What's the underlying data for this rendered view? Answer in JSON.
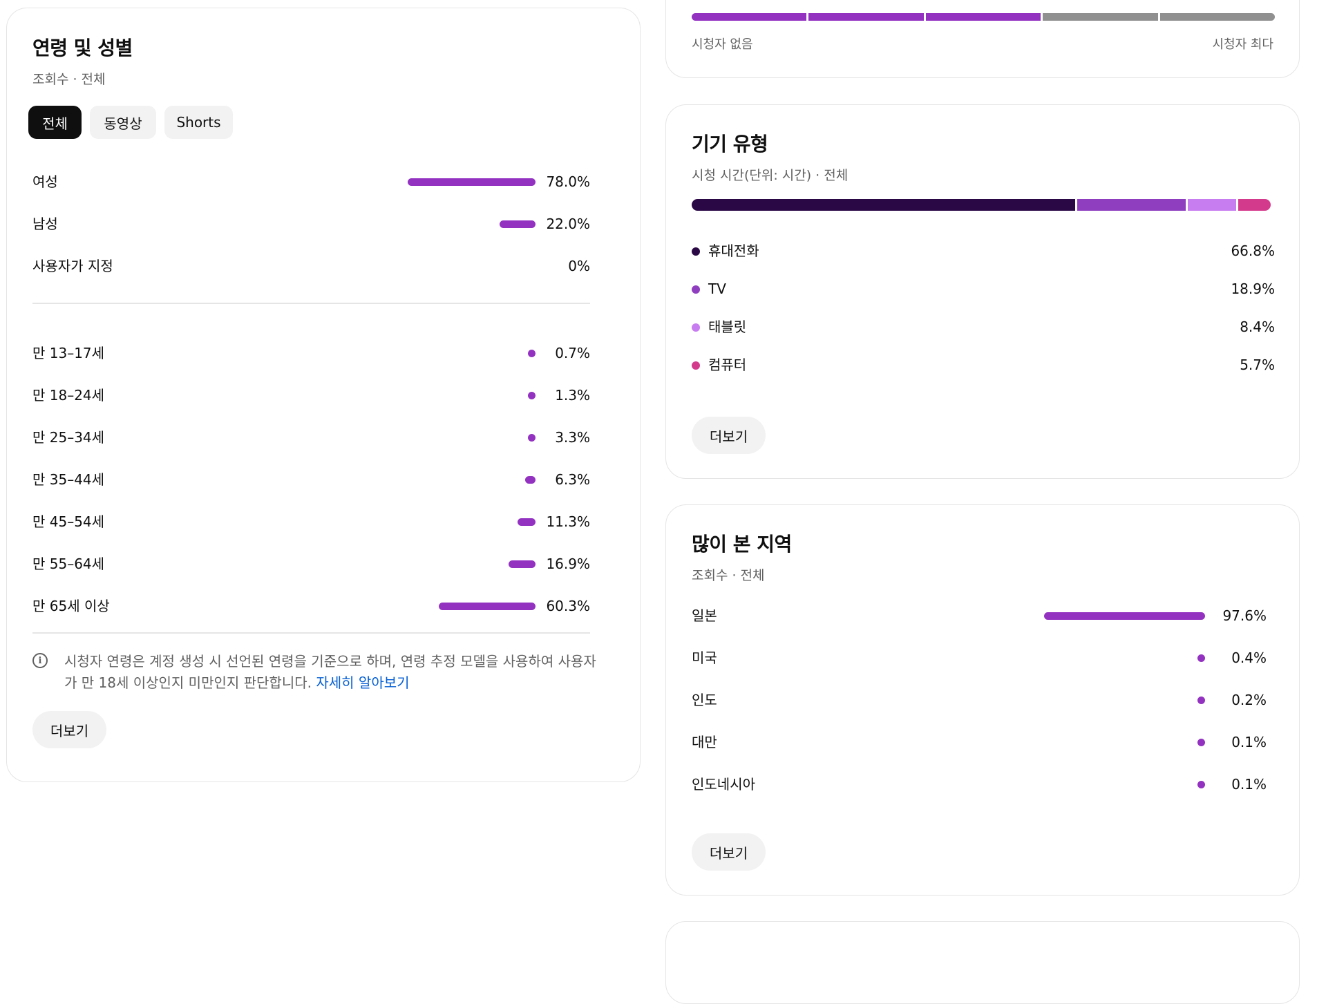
{
  "age_gender": {
    "title": "연령 및 성별",
    "subtitle": "조회수 · 전체",
    "chips": [
      {
        "label": "전체",
        "active": true
      },
      {
        "label": "동영상",
        "active": false
      },
      {
        "label": "Shorts",
        "active": false
      }
    ],
    "gender": [
      {
        "label": "여성",
        "value": "78.0%",
        "pct": 78.0
      },
      {
        "label": "남성",
        "value": "22.0%",
        "pct": 22.0
      },
      {
        "label": "사용자가 지정",
        "value": "0%",
        "pct": 0
      }
    ],
    "ages": [
      {
        "label": "만 13–17세",
        "value": "0.7%",
        "pct": 0.7
      },
      {
        "label": "만 18–24세",
        "value": "1.3%",
        "pct": 1.3
      },
      {
        "label": "만 25–34세",
        "value": "3.3%",
        "pct": 3.3
      },
      {
        "label": "만 35–44세",
        "value": "6.3%",
        "pct": 6.3
      },
      {
        "label": "만 45–54세",
        "value": "11.3%",
        "pct": 11.3
      },
      {
        "label": "만 55–64세",
        "value": "16.9%",
        "pct": 16.9
      },
      {
        "label": "만 65세 이상",
        "value": "60.3%",
        "pct": 60.3
      }
    ],
    "note_text": "시청자 연령은 계정 생성 시 선언된 연령을 기준으로 하며, 연령 추정 모델을 사용하여 사용자가 만 18세 이상인지 미만인지 판단합니다. ",
    "note_link": "자세히 알아보기",
    "more_label": "더보기"
  },
  "top_card": {
    "segments_filled": 3,
    "segments_total": 5,
    "axis_min_label": "시청자 없음",
    "axis_max_label": "시청자 최다",
    "fill_color": "#9332c1",
    "empty_color": "#909090"
  },
  "device": {
    "title": "기기 유형",
    "subtitle": "시청 시간(단위: 시간) · 전체",
    "items": [
      {
        "label": "휴대전화",
        "value": "66.8%",
        "pct": 66.8,
        "color": "#2a0845"
      },
      {
        "label": "TV",
        "value": "18.9%",
        "pct": 18.9,
        "color": "#8e3ebf"
      },
      {
        "label": "태블릿",
        "value": "8.4%",
        "pct": 8.4,
        "color": "#c77cf0"
      },
      {
        "label": "컴퓨터",
        "value": "5.7%",
        "pct": 5.7,
        "color": "#d43a8c"
      }
    ],
    "more_label": "더보기"
  },
  "region": {
    "title": "많이 본 지역",
    "subtitle": "조회수 · 전체",
    "items": [
      {
        "label": "일본",
        "value": "97.6%",
        "pct": 97.6
      },
      {
        "label": "미국",
        "value": "0.4%",
        "pct": 0.4
      },
      {
        "label": "인도",
        "value": "0.2%",
        "pct": 0.2
      },
      {
        "label": "대만",
        "value": "0.1%",
        "pct": 0.1
      },
      {
        "label": "인도네시아",
        "value": "0.1%",
        "pct": 0.1
      }
    ],
    "more_label": "더보기"
  }
}
